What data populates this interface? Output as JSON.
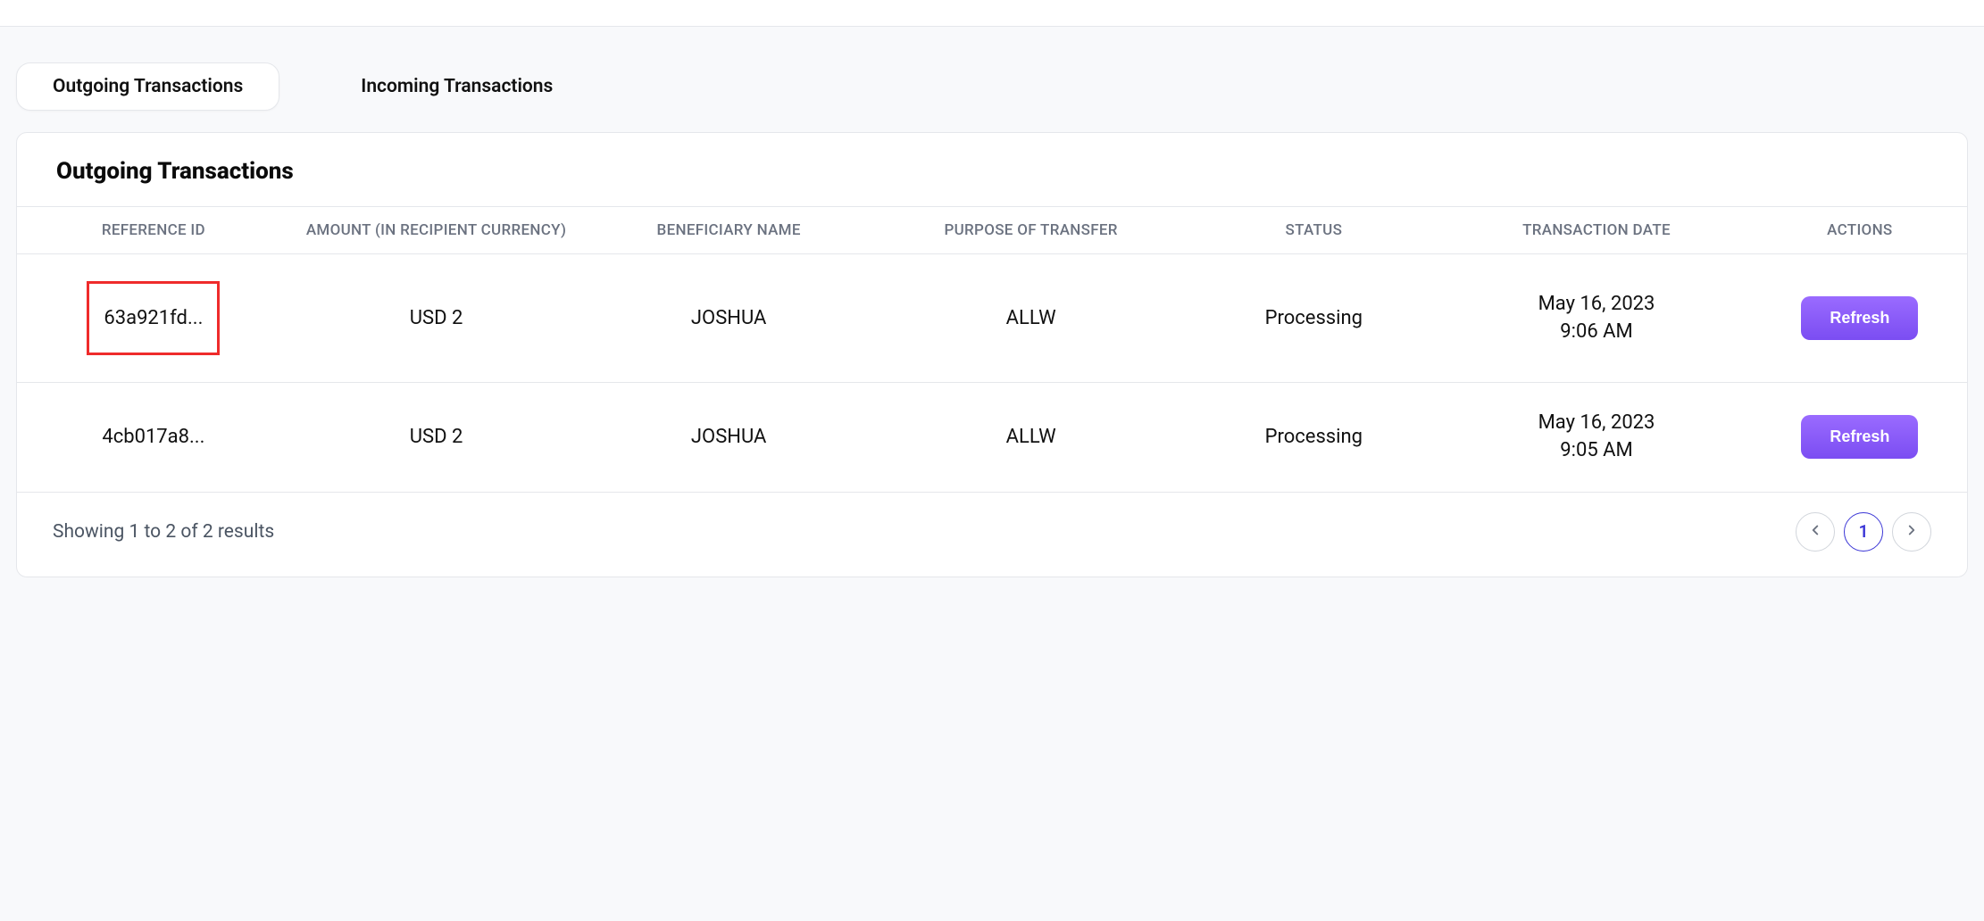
{
  "tabs": {
    "outgoing": "Outgoing Transactions",
    "incoming": "Incoming Transactions"
  },
  "card": {
    "title": "Outgoing Transactions"
  },
  "table": {
    "headers": {
      "reference": "REFERENCE ID",
      "amount": "AMOUNT (IN RECIPIENT CURRENCY)",
      "beneficiary": "BENEFICIARY NAME",
      "purpose": "PURPOSE OF TRANSFER",
      "status": "STATUS",
      "date": "TRANSACTION DATE",
      "actions": "ACTIONS"
    },
    "rows": [
      {
        "reference": "63a921fd...",
        "amount": "USD 2",
        "beneficiary": "JOSHUA",
        "purpose": "ALLW",
        "status": "Processing",
        "date_line1": "May 16, 2023",
        "date_line2": "9:06 AM",
        "action": "Refresh",
        "highlighted": true
      },
      {
        "reference": "4cb017a8...",
        "amount": "USD 2",
        "beneficiary": "JOSHUA",
        "purpose": "ALLW",
        "status": "Processing",
        "date_line1": "May 16, 2023",
        "date_line2": "9:05 AM",
        "action": "Refresh",
        "highlighted": false
      }
    ]
  },
  "footer": {
    "results_text": "Showing 1 to 2 of 2 results",
    "current_page": "1"
  }
}
